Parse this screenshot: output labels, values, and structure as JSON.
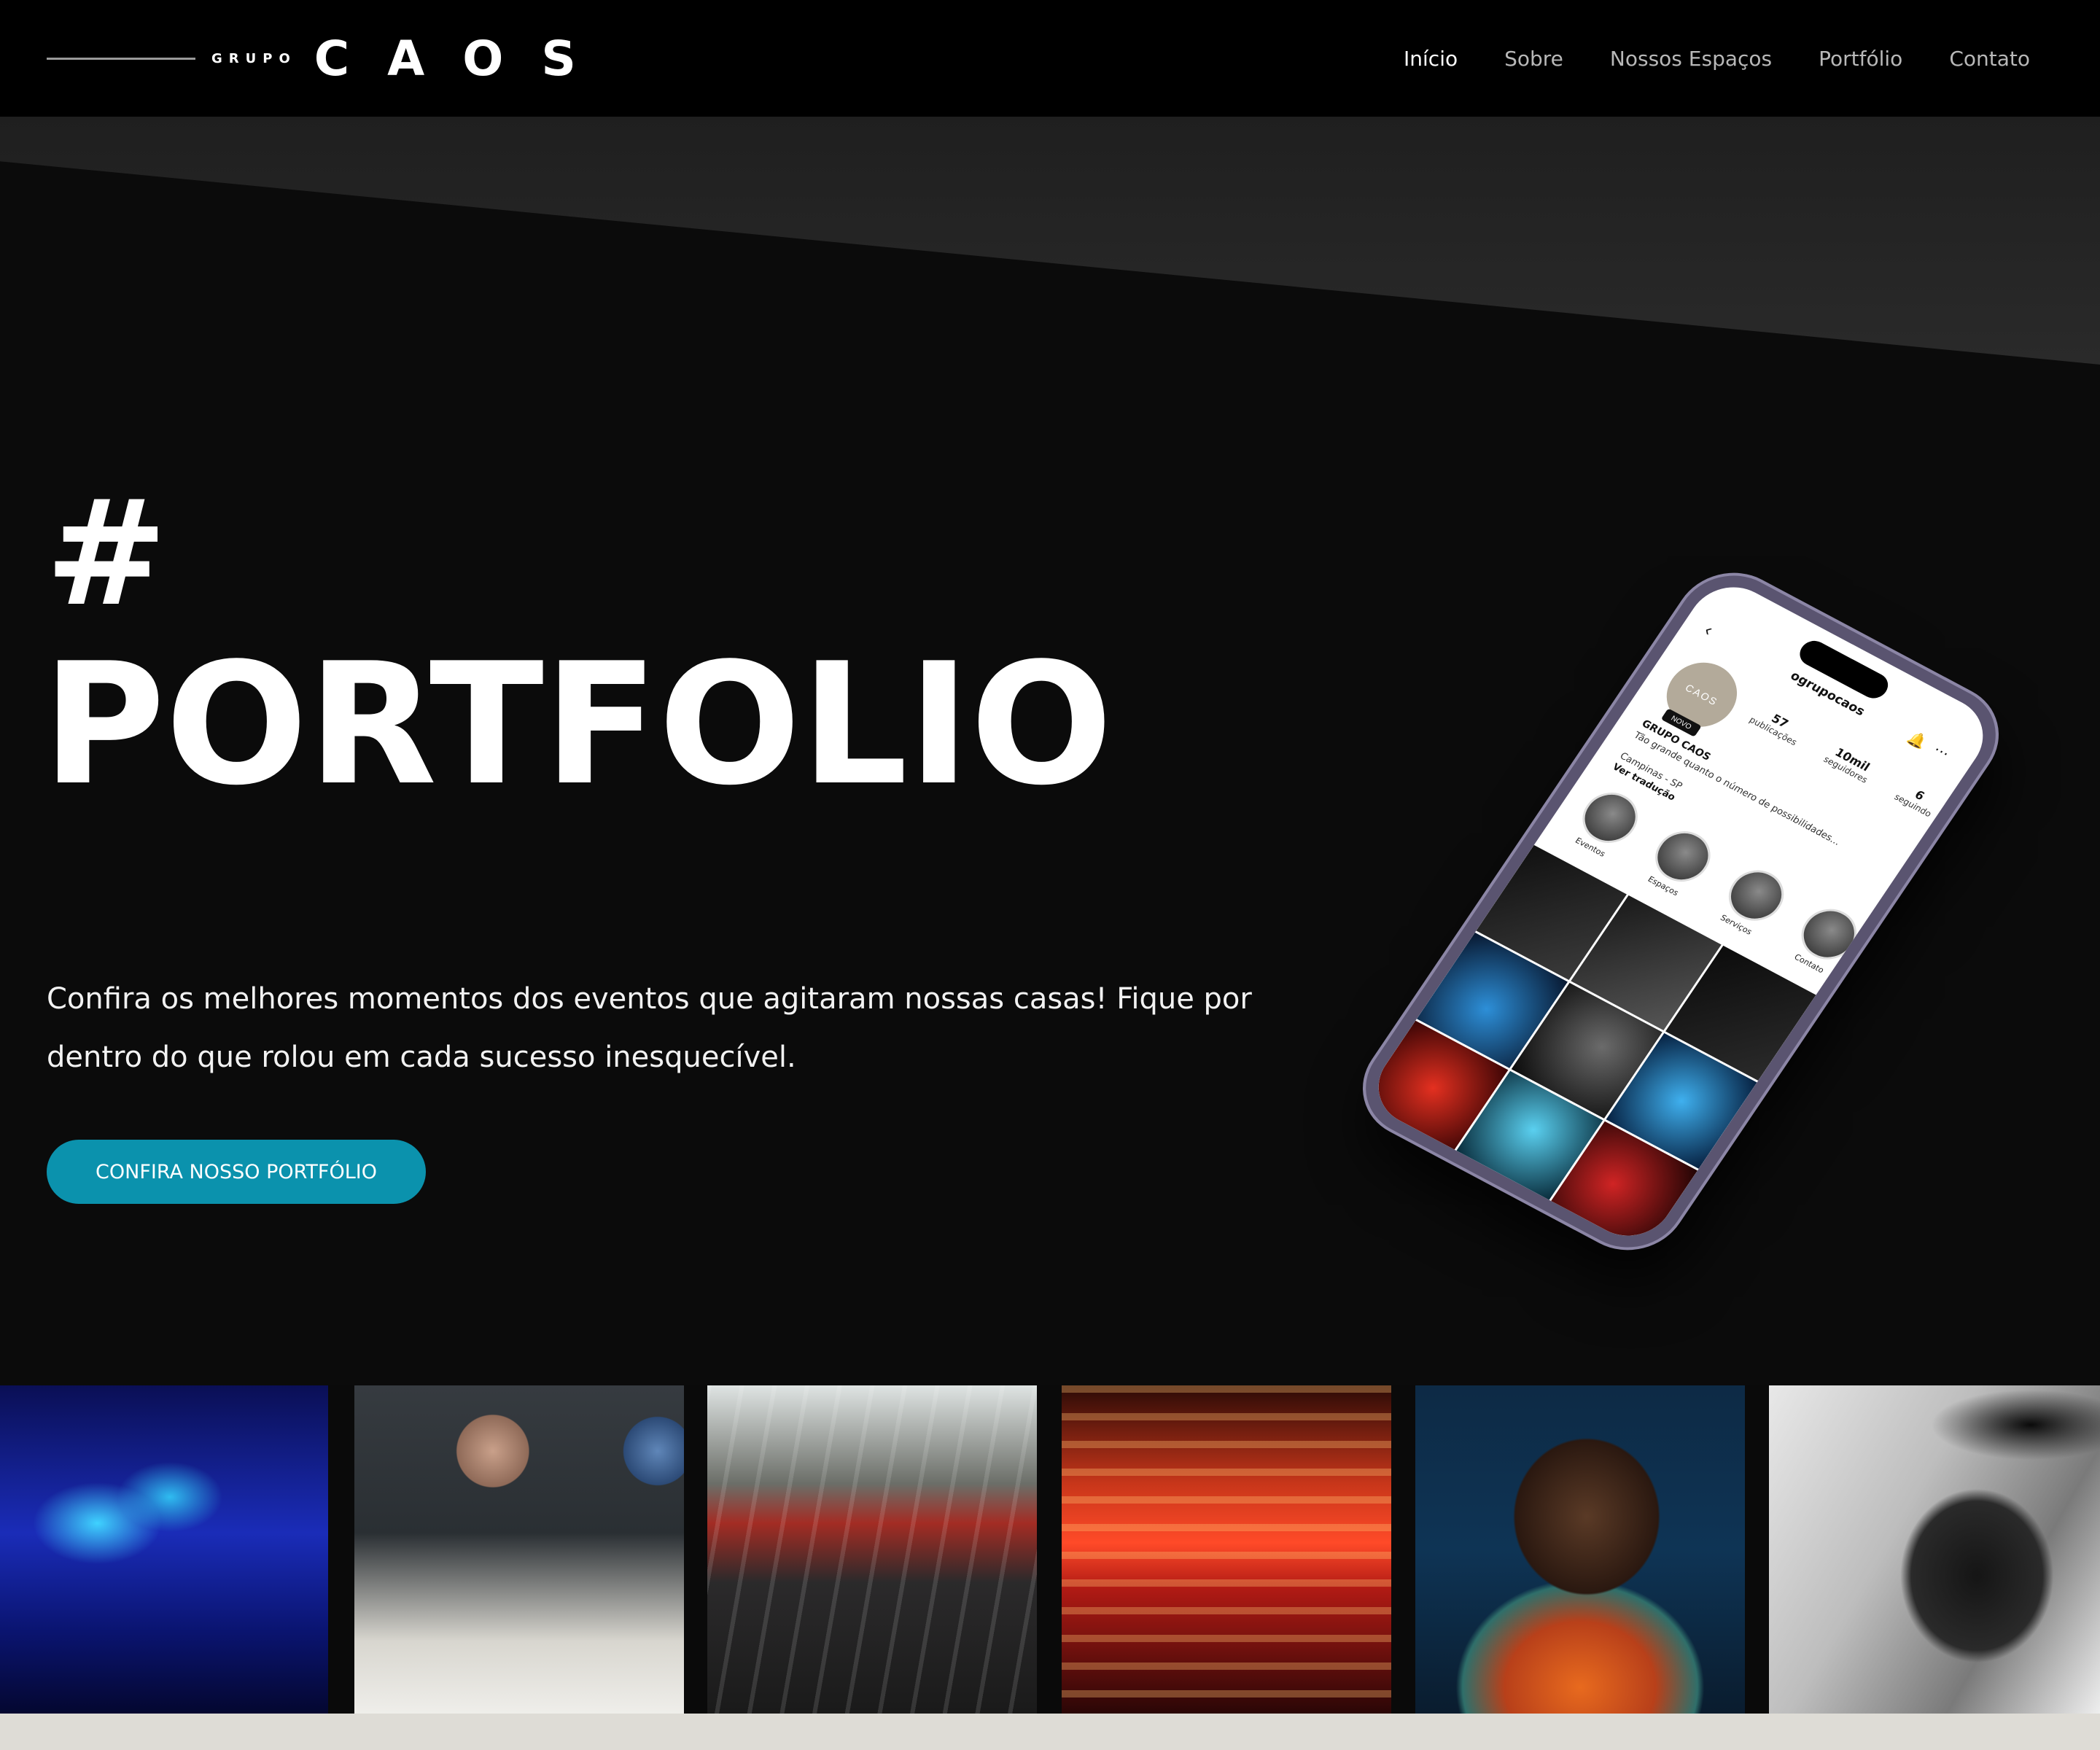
{
  "brand": {
    "grupo": "GRUPO",
    "caos": "CAOS"
  },
  "nav": {
    "items": [
      {
        "label": "Início",
        "active": true
      },
      {
        "label": "Sobre",
        "active": false
      },
      {
        "label": "Nossos Espaços",
        "active": false
      },
      {
        "label": "Portfólio",
        "active": false
      },
      {
        "label": "Contato",
        "active": false
      }
    ]
  },
  "hero": {
    "hash": "#",
    "title": "PORTFOLIO",
    "description": "Confira os melhores momentos dos eventos que agitaram nossas casas! Fique por dentro do que rolou em cada sucesso inesquecível.",
    "cta_label": "CONFIRA NOSSO PORTFÓLIO",
    "accent_color": "#0b92ad"
  },
  "phone_profile": {
    "username": "ogrupocaos",
    "avatar_text": "CAOS",
    "badge": "NOVO",
    "stats": [
      {
        "value": "57",
        "label": "publicações"
      },
      {
        "value": "10mil",
        "label": "seguidores"
      },
      {
        "value": "6",
        "label": "seguindo"
      }
    ],
    "name": "GRUPO CAOS",
    "bio": "Tão grande quanto o número de possibilidades...",
    "location": "Campinas - SP",
    "translate": "Ver tradução",
    "highlights": [
      "Eventos",
      "Espaços",
      "Serviços",
      "Contato"
    ]
  },
  "gallery": {
    "items": [
      "event-photo-auditorium",
      "event-photo-panel-talk",
      "event-photo-crowd-outdoor",
      "event-photo-red-stage",
      "event-photo-singer",
      "event-photo-rapper"
    ]
  }
}
